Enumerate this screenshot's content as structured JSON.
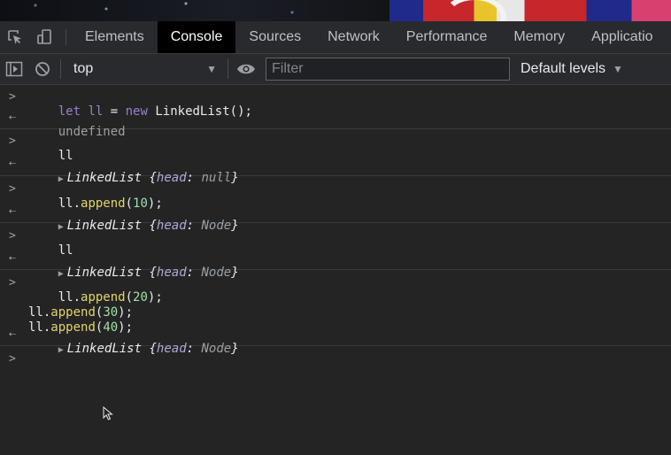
{
  "tabs": {
    "items": [
      "Elements",
      "Console",
      "Sources",
      "Network",
      "Performance",
      "Memory",
      "Applicatio"
    ],
    "active_index": 1
  },
  "toolbar": {
    "context": "top",
    "filter_placeholder": "Filter",
    "levels": "Default levels"
  },
  "console": {
    "entries": [
      {
        "type": "input",
        "code": "let ll = new LinkedList();"
      },
      {
        "type": "output",
        "text": "undefined"
      },
      {
        "type": "input",
        "code": "ll"
      },
      {
        "type": "output",
        "text": "LinkedList {head: null}",
        "class_name": "LinkedList",
        "key": "head",
        "value": "null"
      },
      {
        "type": "input",
        "code": "ll.append(10);"
      },
      {
        "type": "output",
        "text": "LinkedList {head: Node}",
        "class_name": "LinkedList",
        "key": "head",
        "value": "Node"
      },
      {
        "type": "input",
        "code": "ll"
      },
      {
        "type": "output",
        "text": "LinkedList {head: Node}",
        "class_name": "LinkedList",
        "key": "head",
        "value": "Node"
      },
      {
        "type": "input",
        "code": "ll.append(20);\nll.append(30);\nll.append(40);"
      },
      {
        "type": "output",
        "text": "LinkedList {head: Node}",
        "class_name": "LinkedList",
        "key": "head",
        "value": "Node"
      }
    ]
  },
  "colors": {
    "background": "#242424",
    "keyword": "#9a7fd1",
    "function": "#e4d36e",
    "number": "#9de0a8",
    "prompt": "#4d90fe"
  }
}
